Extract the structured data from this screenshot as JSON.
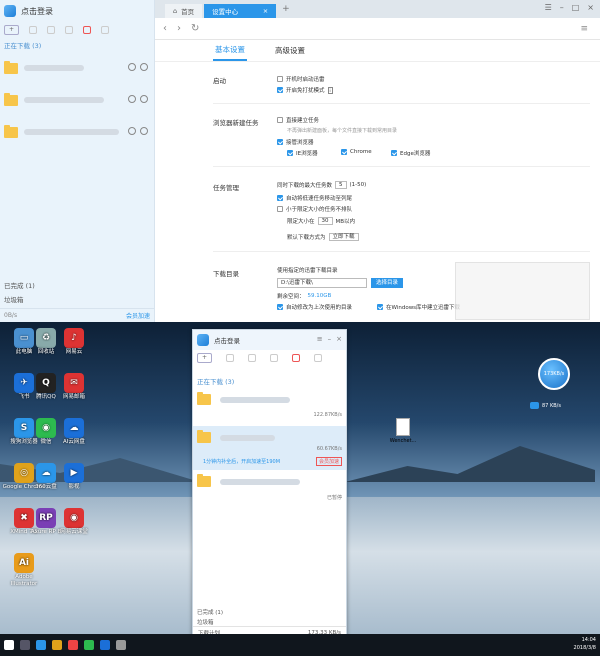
{
  "top_left": {
    "title": "点击登录",
    "toolbar_new": "+",
    "section_downloading": "正在下载 (3)",
    "completed": "已完成 (1)",
    "trash": "垃圾箱",
    "speed": "0B/s",
    "open_speedup": "会员加速"
  },
  "browser": {
    "tab_home": "首页",
    "tab_settings": "设置中心",
    "tab_plus": "+"
  },
  "settings": {
    "tab_basic": "基本设置",
    "tab_advanced": "高级设置",
    "startup": {
      "label": "启动",
      "opt1": "开机时启动迅雷",
      "opt2": "开启免打扰模式"
    },
    "browser_task": {
      "label": "浏览器新建任务",
      "opt1": "直接建立任务",
      "sub": "不再弹出新建面板，每个文件直接下载到常用目录",
      "opt2": "接管浏览器",
      "ie": "IE浏览器",
      "chrome": "Chrome",
      "edge": "Edge浏览器"
    },
    "task_mgmt": {
      "label": "任务管理",
      "max_prefix": "同时下载的最大任务数",
      "max_value": "5",
      "max_range": "(1-50)",
      "opt1": "自动将低速任务移动至列尾",
      "opt2": "小于限定大小的任务不排队",
      "limit_prefix": "限定大小在",
      "limit_value": "30",
      "limit_suffix": "MB以内",
      "mode_prefix": "默认下载方式为",
      "mode_value": "立即下载"
    },
    "dir": {
      "label": "下载目录",
      "desc": "使用指定的迅雷下载目录",
      "path": "D:\\迅雷下载\\",
      "select_btn": "选择目录",
      "free_prefix": "剩余空间：",
      "free_value": "59.10GB",
      "opt1": "自动修改为上次使用的目录",
      "opt2": "在Windows库中建立迅雷下载"
    }
  },
  "mini": {
    "title": "点击登录",
    "section_downloading": "正在下载 (3)",
    "speed1": "122.87KB/s",
    "speed2": "60.67KB/s",
    "speedup_msg": "1分钟内补全后，开启加速至190M",
    "speedup_btn": "会员加速",
    "paused": "已暂停",
    "completed": "已完成 (1)",
    "trash": "垃圾箱",
    "footer_label": "下载计划",
    "footer_speed": "173.33 KB/s"
  },
  "desktop": {
    "float_speed": "173KB/s",
    "float_small": "87 KB/s",
    "file_name": "Wenchet...",
    "icons": [
      {
        "label": "此电脑",
        "color": "#4a90d0",
        "glyph": "▭"
      },
      {
        "label": "回收站",
        "color": "#8aa",
        "glyph": "♻"
      },
      {
        "label": "网易云",
        "color": "#d33",
        "glyph": "♪"
      },
      {
        "label": "飞书",
        "color": "#1b6fd8",
        "glyph": "✈"
      },
      {
        "label": "腾讯QQ",
        "color": "#222",
        "glyph": "Q"
      },
      {
        "label": "网易邮箱",
        "color": "#d33",
        "glyph": "✉"
      },
      {
        "label": "搜狗浏览器",
        "color": "#2b96e9",
        "glyph": "S"
      },
      {
        "label": "微信",
        "color": "#2dbb4f",
        "glyph": "◉"
      },
      {
        "label": "AI云网盘",
        "color": "#1b6fd8",
        "glyph": "☁"
      },
      {
        "label": "Google Chrome",
        "color": "#e0a21b",
        "glyph": "◎"
      },
      {
        "label": "360云盘",
        "color": "#2b96e9",
        "glyph": "☁"
      },
      {
        "label": "影视",
        "color": "#1b6fd8",
        "glyph": "▶"
      },
      {
        "label": "XMind 7.5",
        "color": "#d33",
        "glyph": "✖"
      },
      {
        "label": "Axure RP 8",
        "color": "#7a3fb5",
        "glyph": "RP"
      },
      {
        "label": "网易云课堂",
        "color": "#d33",
        "glyph": "◉"
      },
      {
        "label": "Adobe Illustrator",
        "color": "#e89b1a",
        "glyph": "Ai"
      }
    ],
    "clock": "14:04",
    "date": "2018/3/8"
  }
}
